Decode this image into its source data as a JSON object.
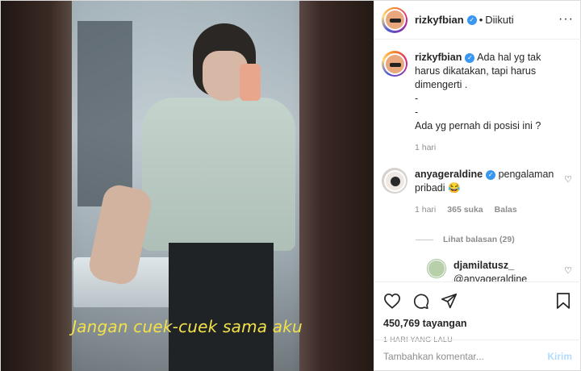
{
  "video": {
    "caption": "Jangan cuek-cuek sama aku"
  },
  "header": {
    "username": "rizkyfbian",
    "verified_icon": "verified-badge-icon",
    "separator": "•",
    "follow_status": "Diikuti",
    "more_icon": "more-options-icon"
  },
  "post_caption": {
    "username": "rizkyfbian",
    "line1": "Ada hal yg tak harus dikatakan, tapi harus dimengerti .",
    "line2": "-",
    "line3": "-",
    "line4": "Ada yg pernah di posisi ini ?",
    "time": "1 hari"
  },
  "comments": [
    {
      "username": "anyageraldine",
      "text": "pengalaman pribadi 😂",
      "time": "1 hari",
      "likes": "365 suka",
      "reply": "Balas",
      "view_replies": "Lihat balasan (29)"
    },
    {
      "username": "djamilatusz_",
      "text": "@anyageraldine @rizkyfbian hajatan terkabulkan nih lama lama 😂"
    }
  ],
  "actions": {
    "like_icon": "heart-icon",
    "comment_icon": "comment-icon",
    "share_icon": "share-icon",
    "save_icon": "bookmark-icon",
    "views": "450,769 tayangan",
    "posted": "1 HARI YANG LALU"
  },
  "add_comment": {
    "placeholder": "Tambahkan komentar...",
    "post_label": "Kirim"
  },
  "colors": {
    "verified": "#3897f0",
    "caption_text": "#f2e14a",
    "post_button": "#b3dbff"
  }
}
